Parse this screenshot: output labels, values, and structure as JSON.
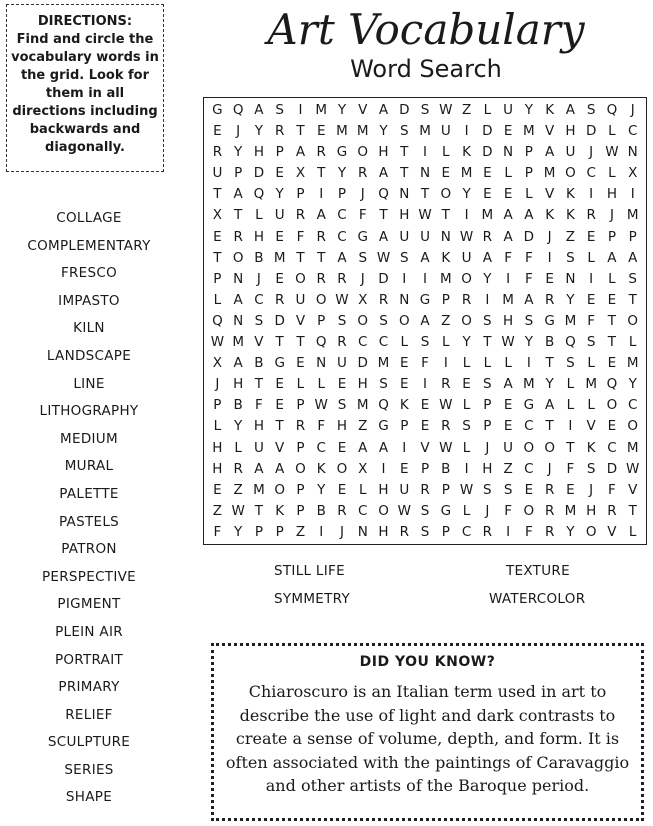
{
  "directions": {
    "title": "DIRECTIONS:",
    "text": "Find and circle the vocabulary words in the grid.  Look for them in all directions including backwards and diagonally."
  },
  "title": "Art Vocabulary",
  "subtitle": "Word Search",
  "words": [
    "COLLAGE",
    "COMPLEMENTARY",
    "FRESCO",
    "IMPASTO",
    "KILN",
    "LANDSCAPE",
    "LINE",
    "LITHOGRAPHY",
    "MEDIUM",
    "MURAL",
    "PALETTE",
    "PASTELS",
    "PATRON",
    "PERSPECTIVE",
    "PIGMENT",
    "PLEIN AIR",
    "PORTRAIT",
    "PRIMARY",
    "RELIEF",
    "SCULPTURE",
    "SERIES",
    "SHAPE"
  ],
  "extra_words": [
    "STILL LIFE",
    "SYMMETRY",
    "TEXTURE",
    "WATERCOLOR"
  ],
  "grid": [
    "GQASIMYVADSWZLUYKASQJ",
    "EJYRTEMMYSMUIDEMVHDLC",
    "RYHPARGOHTILKDNPAUJWN",
    "UPDEXTYRATNEMELPMOCLX",
    "TAQYPIPJQNTOYEELVKIHI",
    "XTLURACFTHWTIMAAKKRJM",
    "ERHEFRCGAUUNWRADJZEPP",
    "TOBMTTASWSAKUAFFISLAA",
    "PNJEORRJDIIMOYIFENILS",
    "LACRUOWXRNGPRIMARYEET",
    "QNSDVPSOSOAZOSHSGMFTO",
    "WMVTTQRCCLSLYTWYBQSTL",
    "XABGENUDMEFILLLITSLEM",
    "JHTELLEHSEIRESAMYLMQY",
    "PBFEPWSMQKEWLPEGALLOC",
    "LYHTRFHZGPERSPECTIVEO",
    "HLUVPCEAAIVWLJUOOTKCM",
    "HRAAOKOXIEPBIHZCJFSDW",
    "EZMOPYELHURPWSSEREJFV",
    "ZWTKPBRCOWSGLJFORMHRT",
    "FYPPZIJNHRSPCRIFRYOVL"
  ],
  "did_you_know": {
    "title": "DID YOU KNOW?",
    "text": "Chiaroscuro is an Italian term used in art to describe the use of light and dark contrasts to create a sense of volume, depth, and form. It is often associated with the paintings of Caravaggio and other artists of the Baroque period."
  }
}
